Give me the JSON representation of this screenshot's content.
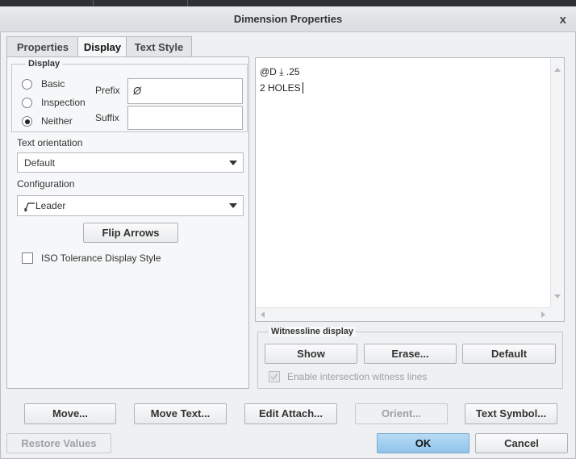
{
  "dialog": {
    "title": "Dimension Properties",
    "close_glyph": "x"
  },
  "tabs": [
    {
      "label": "Properties"
    },
    {
      "label": "Display"
    },
    {
      "label": "Text Style"
    }
  ],
  "display_group": {
    "title": "Display",
    "options": [
      "Basic",
      "Inspection",
      "Neither"
    ],
    "selected": "Neither",
    "prefix_label": "Prefix",
    "prefix_value": "Ø",
    "suffix_label": "Suffix",
    "suffix_value": ""
  },
  "text_orientation": {
    "label": "Text orientation",
    "value": "Default"
  },
  "configuration": {
    "label": "Configuration",
    "value": "Leader"
  },
  "flip_arrows_label": "Flip Arrows",
  "iso_tolerance_label": "ISO Tolerance Display Style",
  "text_content": {
    "line1_prefix": "@D",
    "line1_symbol": "⤓",
    "line1_suffix": ".25",
    "line2": "2 HOLES"
  },
  "witnessline": {
    "title": "Witnessline display",
    "show_label": "Show",
    "erase_label": "Erase...",
    "default_label": "Default",
    "intersection_label": "Enable intersection witness lines"
  },
  "bottom_buttons": {
    "move": "Move...",
    "move_text": "Move Text...",
    "edit_attach": "Edit Attach...",
    "orient": "Orient...",
    "text_symbol": "Text Symbol...",
    "restore_values": "Restore Values",
    "ok": "OK",
    "cancel": "Cancel"
  }
}
